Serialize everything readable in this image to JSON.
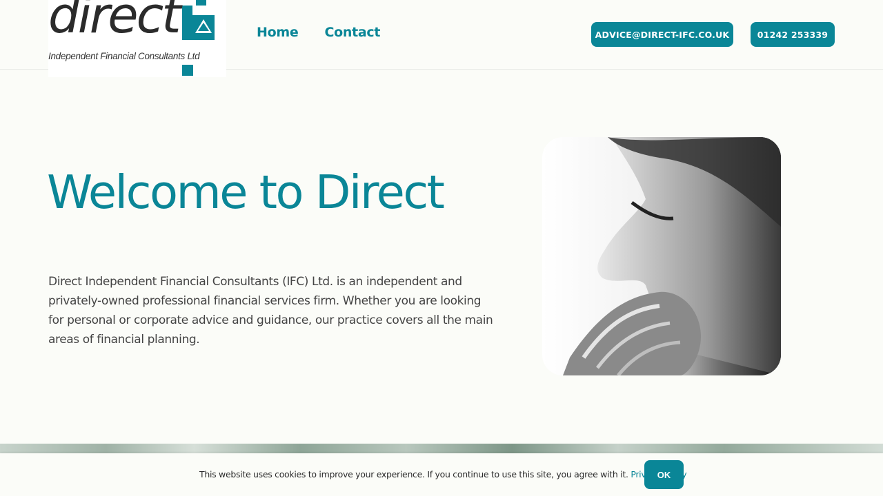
{
  "logo": {
    "word": "direct",
    "tagline": "Independent Financial Consultants Ltd"
  },
  "nav": {
    "items": [
      {
        "label": "Home"
      },
      {
        "label": "Contact"
      }
    ]
  },
  "header_buttons": {
    "email": "ADVICE@DIRECT-IFC.CO.UK",
    "phone": "01242 253339"
  },
  "hero": {
    "title": "Welcome to Direct",
    "body": "Direct Independent Financial Consultants (IFC) Ltd. is an independent and privately-owned professional financial services firm. Whether you are looking for personal or corporate advice and guidance, our practice covers all the main areas of financial planning."
  },
  "cookie_bar": {
    "message": "This website uses cookies to improve your experience. If you continue to use this site, you agree with it.",
    "link_label": "Privacy Policy",
    "ok_label": "OK"
  },
  "colors": {
    "accent": "#0a8697",
    "background": "#fbfcf8",
    "text": "#3a3a3a"
  },
  "icons": [
    "logo-squares-icon"
  ]
}
